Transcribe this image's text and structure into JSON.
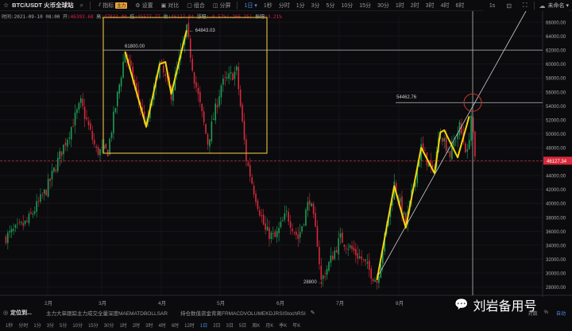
{
  "toolbar": {
    "symbol": "BTC/USDT 火币全球站",
    "indicators": "指标",
    "indicators_badge": "主力",
    "settings": "设置",
    "compare": "对比",
    "combine": "组合",
    "split": "分屏",
    "interval": "1日",
    "timeframes": [
      "1秒",
      "分时",
      "1分",
      "3分",
      "5分",
      "10分",
      "15分",
      "30分",
      "1时",
      "2时",
      "3时",
      "4时",
      "6时"
    ],
    "realtime": "1s",
    "account": "未命名"
  },
  "info": {
    "time_label": "时间:",
    "time": "2021-09-10 08:00",
    "open_label": "开:",
    "open": "46393.68",
    "high_label": "高:",
    "high": "47033.00",
    "low_label": "低:",
    "low": "45577.77",
    "close_label": "收:",
    "close": "46127.34",
    "change_label": "涨幅:",
    "change": "-0.57%(-266.35)",
    "amp_label": "振幅:",
    "amp": "3.21%"
  },
  "axis": {
    "ticks": [
      "66000.00",
      "64000.00",
      "62000.00",
      "60000.00",
      "58000.00",
      "56000.00",
      "54000.00",
      "52000.00",
      "50000.00",
      "48000.00",
      "44000.00",
      "42000.00",
      "40000.00",
      "38000.00",
      "36000.00",
      "34000.00",
      "32000.00",
      "30000.00",
      "28000.00"
    ],
    "current_price": "46127.34"
  },
  "months": [
    "2月",
    "3月",
    "4月",
    "5月",
    "6月",
    "7月",
    "8月"
  ],
  "annotations": {
    "high_a": "61800.00",
    "high_b": "← 64843.03",
    "target": "54462.76",
    "low": "28800 →"
  },
  "indicators_row": {
    "locate": "定位到...",
    "main": "主力大单跟踪主力成交全量深度MAEMATDBOLLSAR",
    "sub": "持仓数值资金背离FRMACDVOLUMEKDJRSIStochRSI",
    "log": "对数",
    "pct": "%",
    "auto": "自动"
  },
  "bottom_timeframes": [
    "1秒",
    "分时",
    "1分",
    "3分",
    "5分",
    "10分",
    "15分",
    "30分",
    "1时",
    "2时",
    "3时",
    "4时",
    "6时",
    "12时",
    "1日",
    "2日",
    "3日",
    "5日",
    "周K",
    "月K",
    "季K",
    "年K"
  ],
  "active_bottom_tf": "1日",
  "watermark": "刘岩备用号",
  "colors": {
    "up": "#1f9d55",
    "down": "#d8293a",
    "zigzag": "#f5d60a",
    "box": "#d9b23a"
  },
  "chart_data": {
    "type": "candlestick",
    "ylim": [
      27000,
      67000
    ],
    "price_waypoints": [
      [
        0,
        35000
      ],
      [
        12,
        37300
      ],
      [
        22,
        41900
      ],
      [
        30,
        47500
      ],
      [
        40,
        54400
      ],
      [
        48,
        47500
      ],
      [
        54,
        47500
      ],
      [
        63,
        61800
      ],
      [
        74,
        51000
      ],
      [
        81,
        60000
      ],
      [
        87,
        55700
      ],
      [
        95,
        64843
      ],
      [
        99,
        58000
      ],
      [
        106,
        48700
      ],
      [
        113,
        57000
      ],
      [
        121,
        59000
      ],
      [
        126,
        46400
      ],
      [
        130,
        41900
      ],
      [
        136,
        36000
      ],
      [
        141,
        35000
      ],
      [
        147,
        38500
      ],
      [
        153,
        35000
      ],
      [
        159,
        40700
      ],
      [
        163,
        34500
      ],
      [
        165,
        28800
      ],
      [
        175,
        35000
      ],
      [
        186,
        32000
      ],
      [
        194,
        28800
      ],
      [
        203,
        42800
      ],
      [
        209,
        37000
      ],
      [
        217,
        48000
      ],
      [
        223,
        44400
      ],
      [
        227,
        50400
      ],
      [
        232,
        47000
      ],
      [
        237,
        51000
      ],
      [
        241,
        47000
      ],
      [
        243,
        52700
      ],
      [
        245,
        46127
      ]
    ],
    "zigzag_left": [
      [
        63,
        61800
      ],
      [
        74,
        51000
      ],
      [
        81,
        60000
      ],
      [
        84,
        60300
      ],
      [
        87,
        55700
      ],
      [
        95,
        64843
      ]
    ],
    "zigzag_right": [
      [
        194,
        29000
      ],
      [
        203,
        42500
      ],
      [
        209,
        36500
      ],
      [
        217,
        48000
      ],
      [
        224,
        44300
      ],
      [
        227,
        50200
      ],
      [
        229,
        50500
      ],
      [
        236,
        46600
      ],
      [
        242,
        52500
      ]
    ],
    "levels": [
      62000,
      54462.76,
      46127.34
    ]
  }
}
